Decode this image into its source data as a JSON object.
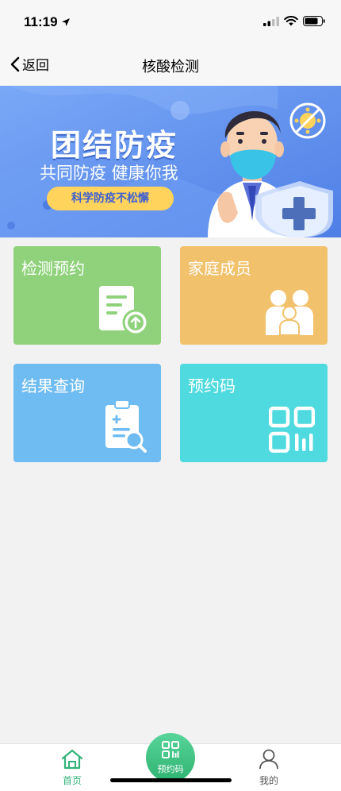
{
  "status": {
    "time": "11:19"
  },
  "nav": {
    "back_label": "返回",
    "title": "核酸检测"
  },
  "banner": {
    "title": "团结防疫",
    "subtitle": "共同防疫 健康你我",
    "pill": "科学防疫不松懈",
    "colors": {
      "background": "#5b8ff0",
      "pill": "#ffd35c"
    }
  },
  "cards": [
    {
      "label": "检测预约",
      "color": "#8fd27b",
      "icon": "document-upload-icon"
    },
    {
      "label": "家庭成员",
      "color": "#f2c16c",
      "icon": "family-icon"
    },
    {
      "label": "结果查询",
      "color": "#6fbcf2",
      "icon": "clipboard-search-icon"
    },
    {
      "label": "预约码",
      "color": "#4fdadf",
      "icon": "qr-code-icon"
    }
  ],
  "tabbar": {
    "home_label": "首页",
    "code_label": "预约码",
    "me_label": "我的",
    "active_color": "#33b37a"
  }
}
